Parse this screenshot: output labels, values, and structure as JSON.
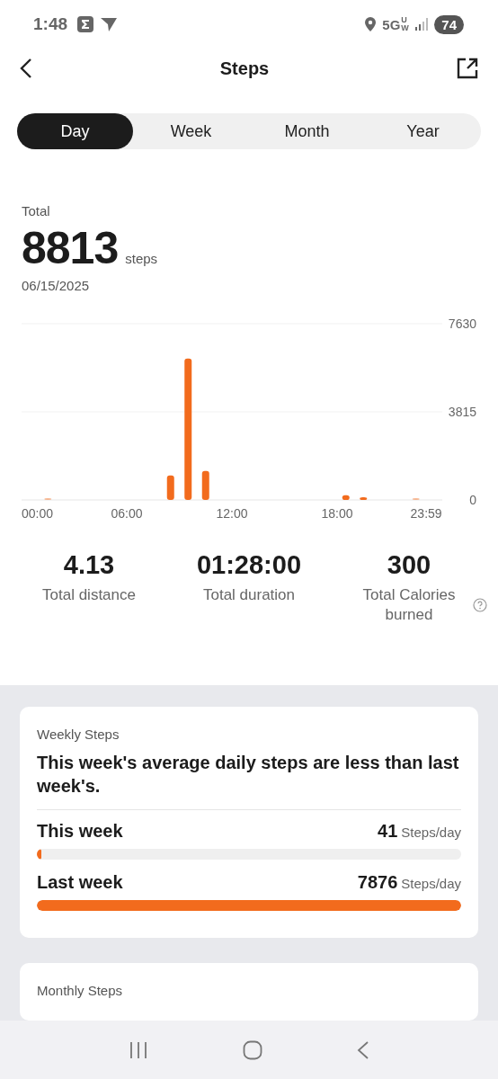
{
  "status_bar": {
    "time": "1:48",
    "network": "5G",
    "network_sub": "UW",
    "battery": "74"
  },
  "header": {
    "title": "Steps"
  },
  "tabs": [
    {
      "label": "Day",
      "selected": true
    },
    {
      "label": "Week",
      "selected": false
    },
    {
      "label": "Month",
      "selected": false
    },
    {
      "label": "Year",
      "selected": false
    }
  ],
  "summary": {
    "label": "Total",
    "value": "8813",
    "unit": "steps",
    "date": "06/15/2025"
  },
  "chart_data": {
    "type": "bar",
    "x": [
      1.5,
      8.5,
      9.5,
      10.5,
      18.5,
      19.5,
      22.5
    ],
    "series": [
      {
        "color": "#f26b1d",
        "values": [
          20,
          1060,
          6120,
          1260,
          200,
          120,
          30
        ]
      }
    ],
    "xlim": [
      0,
      24
    ],
    "ylim": [
      0,
      7630
    ],
    "xticks": [
      {
        "value": 0,
        "label": "00:00"
      },
      {
        "value": 6,
        "label": "06:00"
      },
      {
        "value": 12,
        "label": "12:00"
      },
      {
        "value": 18,
        "label": "18:00"
      },
      {
        "value": 23.98,
        "label": "23:59"
      }
    ],
    "yticks": [
      0,
      3815,
      7630
    ]
  },
  "stats": [
    {
      "value": "4.13",
      "label": "Total distance",
      "help": false
    },
    {
      "value": "01:28:00",
      "label": "Total duration",
      "help": false
    },
    {
      "value": "300",
      "label": "Total Calories burned",
      "help": true
    }
  ],
  "weekly": {
    "title": "Weekly Steps",
    "message": "This week's average daily steps are less than last week's.",
    "rows": [
      {
        "label": "This week",
        "value": "41",
        "unit": "Steps/day",
        "level": 0.01
      },
      {
        "label": "Last week",
        "value": "7876",
        "unit": "Steps/day",
        "level": 1
      }
    ]
  },
  "monthly": {
    "title": "Monthly Steps"
  }
}
